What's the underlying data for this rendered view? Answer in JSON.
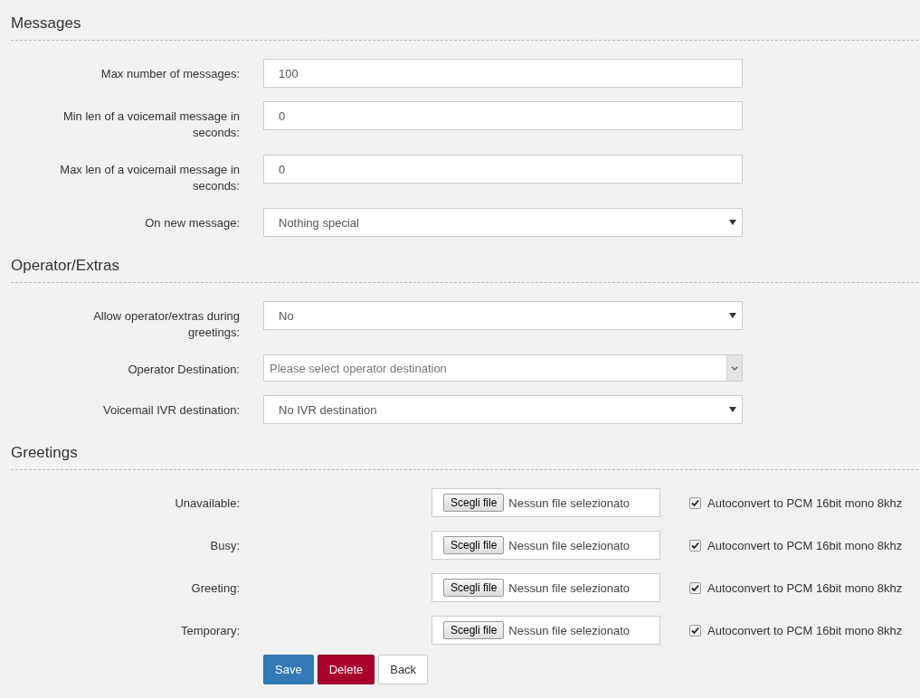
{
  "sections": [
    {
      "title": "Messages",
      "fields": [
        {
          "kind": "text",
          "label": "Max number of messages:",
          "value": "100"
        },
        {
          "kind": "text",
          "label": "Min len of a voicemail message in seconds:",
          "value": "0"
        },
        {
          "kind": "text",
          "label": "Max len of a voicemail message in seconds:",
          "value": "0"
        },
        {
          "kind": "select",
          "label": "On new message:",
          "value": "Nothing special"
        }
      ]
    },
    {
      "title": "Operator/Extras",
      "fields": [
        {
          "kind": "select",
          "label": "Allow operator/extras during greetings:",
          "value": "No"
        },
        {
          "kind": "combo",
          "label": "Operator Destination:",
          "placeholder": "Please select operator destination"
        },
        {
          "kind": "select",
          "label": "Voicemail IVR destination:",
          "value": "No IVR destination"
        }
      ]
    }
  ],
  "greetings": {
    "title": "Greetings",
    "files": [
      {
        "label": "Unavailable:",
        "button": "Scegli file",
        "status": "Nessun file selezionato",
        "option": "Autoconvert to PCM 16bit mono 8khz",
        "checked": true
      },
      {
        "label": "Busy:",
        "button": "Scegli file",
        "status": "Nessun file selezionato",
        "option": "Autoconvert to PCM 16bit mono 8khz",
        "checked": true
      },
      {
        "label": "Greeting:",
        "button": "Scegli file",
        "status": "Nessun file selezionato",
        "option": "Autoconvert to PCM 16bit mono 8khz",
        "checked": true
      },
      {
        "label": "Temporary:",
        "button": "Scegli file",
        "status": "Nessun file selezionato",
        "option": "Autoconvert to PCM 16bit mono 8khz",
        "checked": true
      }
    ]
  },
  "buttons": [
    {
      "label": "Save",
      "kind": "primary"
    },
    {
      "label": "Delete",
      "kind": "danger"
    },
    {
      "label": "Back",
      "kind": "default"
    }
  ]
}
